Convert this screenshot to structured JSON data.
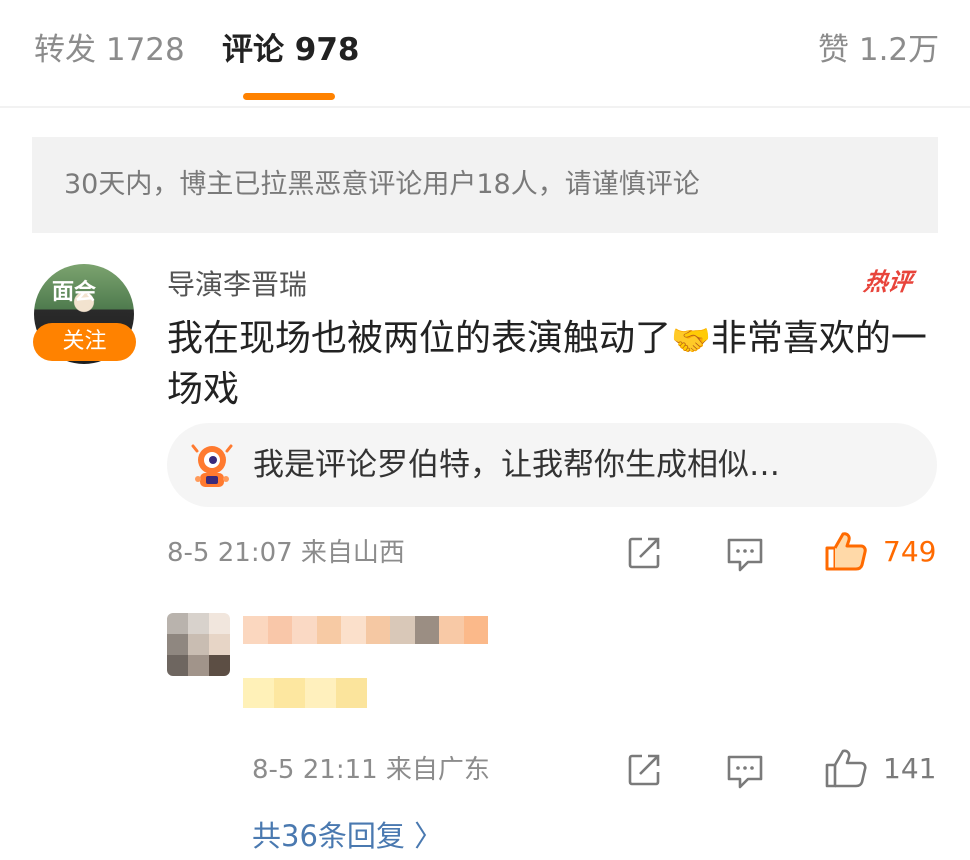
{
  "tabs": {
    "repost_label": "转发 1728",
    "comments_label": "评论 978",
    "likes_label": "赞 1.2万"
  },
  "notice": "30天内，博主已拉黑恶意评论用户18人，请谨慎评论",
  "comment": {
    "avatar_text": "面会",
    "follow_label": "关注",
    "username": "导演李晋瑞",
    "hot_badge": "热评",
    "text_before_emoji": "我在现场也被两位的表演触动了",
    "emoji": "🤝",
    "text_after_emoji": "非常喜欢的一场戏",
    "bot_prompt": "我是评论罗伯特，让我帮你生成相似…",
    "time_location": "8-5 21:07  来自山西",
    "like_count": "749"
  },
  "reply": {
    "time_location": "8-5 21:11  来自广东",
    "like_count": "141"
  },
  "more_replies": "共36条回复 〉",
  "colors": {
    "accent": "#ff8200",
    "link": "#4a79b0",
    "hot": "#e8443b",
    "muted": "#8c8c8c"
  }
}
